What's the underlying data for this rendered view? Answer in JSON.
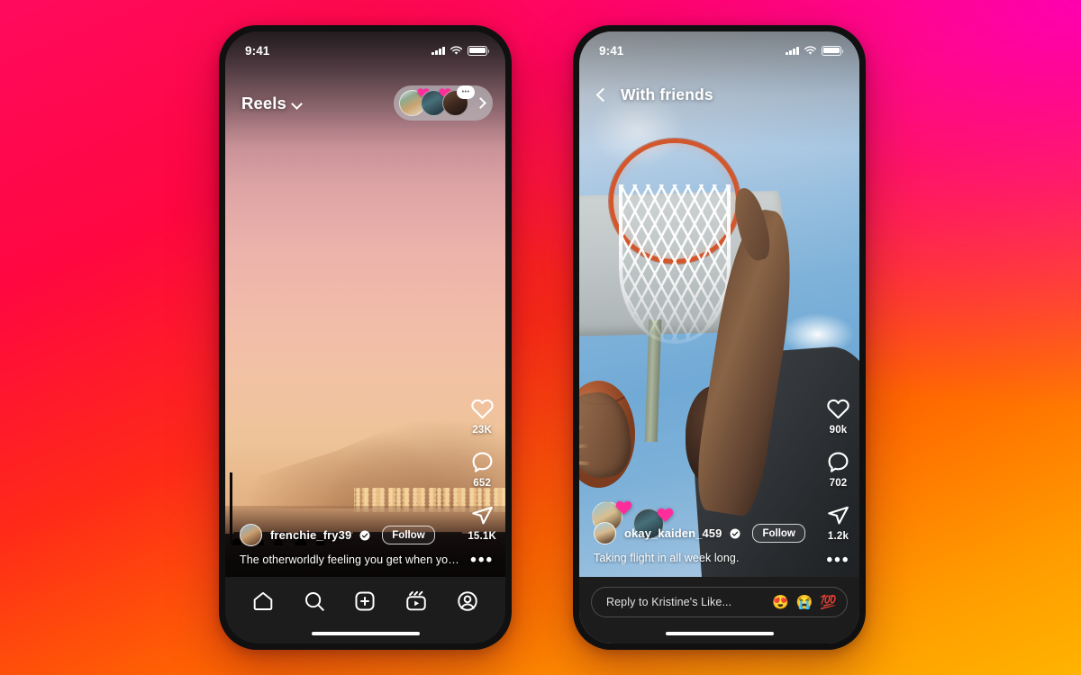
{
  "background": {
    "gradient_from": "#ff0a5e",
    "gradient_mid": "#ff2a18",
    "gradient_to": "#ffb300",
    "accent_magenta": "#ff00b0"
  },
  "phones": {
    "left": {
      "name": "reels-feed",
      "status_bar": {
        "time": "9:41",
        "signal_icon": "cellular-signal-icon",
        "wifi_icon": "wifi-icon",
        "battery_icon": "battery-icon"
      },
      "header": {
        "title": "Reels",
        "chevron_icon": "chevron-down-icon",
        "tray": {
          "avatars": [
            {
              "name": "tray-avatar-1",
              "reaction": "heart-sticker"
            },
            {
              "name": "tray-avatar-2",
              "reaction": "heart-sticker"
            },
            {
              "name": "tray-avatar-3",
              "reaction": "speech-bubble-sticker",
              "bubble_text": "•••"
            }
          ],
          "chevron_icon": "chevron-right-icon"
        }
      },
      "actions": [
        {
          "icon": "heart-icon",
          "label": "like-button",
          "count": "23K"
        },
        {
          "icon": "comment-icon",
          "label": "comment-button",
          "count": "652"
        },
        {
          "icon": "share-icon",
          "label": "share-button",
          "count": "15.1K"
        }
      ],
      "more_icon": "more-options-icon",
      "more_glyph": "•••",
      "audio_icon": "audio-track-icon",
      "audio_note_glyph": "♫",
      "post": {
        "username": "frenchie_fry39",
        "verified": true,
        "follow_label": "Follow",
        "caption": "The otherworldly feeling you get when you d..."
      },
      "tabbar": [
        {
          "name": "tab-home",
          "icon": "home-icon"
        },
        {
          "name": "tab-search",
          "icon": "search-icon"
        },
        {
          "name": "tab-create",
          "icon": "plus-square-icon"
        },
        {
          "name": "tab-reels",
          "icon": "reels-icon"
        },
        {
          "name": "tab-profile",
          "icon": "profile-icon"
        }
      ]
    },
    "right": {
      "name": "with-friends-feed",
      "status_bar": {
        "time": "9:41",
        "signal_icon": "cellular-signal-icon",
        "wifi_icon": "wifi-icon",
        "battery_icon": "battery-icon"
      },
      "header": {
        "back_icon": "back-chevron-icon",
        "title": "With friends"
      },
      "actions": [
        {
          "icon": "heart-icon",
          "label": "like-button",
          "count": "90k"
        },
        {
          "icon": "comment-icon",
          "label": "comment-button",
          "count": "702"
        },
        {
          "icon": "share-icon",
          "label": "share-button",
          "count": "1.2k"
        }
      ],
      "more_icon": "more-options-icon",
      "more_glyph": "•••",
      "audio_icon": "audio-track-icon",
      "audio_note_glyph": "♫",
      "reaction_stickers": [
        {
          "name": "reaction-sticker-1",
          "emoji": "heart-sticker"
        },
        {
          "name": "reaction-sticker-2",
          "emoji": "heart-sticker"
        }
      ],
      "post": {
        "username": "okay_kaiden_459",
        "verified": true,
        "follow_label": "Follow",
        "caption": "Taking flight in all week long."
      },
      "reply": {
        "placeholder": "Reply to Kristine's Like...",
        "quick_reactions": [
          "😍",
          "😭",
          "💯"
        ]
      }
    }
  }
}
